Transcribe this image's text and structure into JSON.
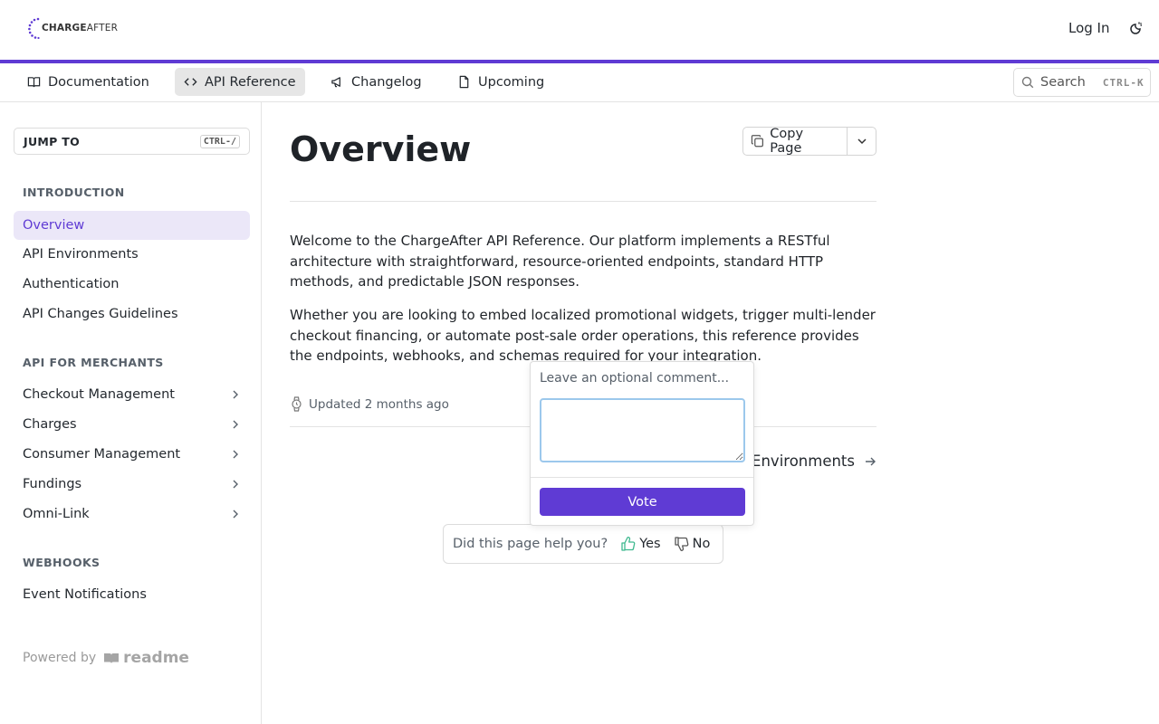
{
  "header": {
    "logo_text_bold": "CHARGE",
    "logo_text_thin": "AFTER",
    "login_label": "Log In",
    "theme_icon": "theme-toggle-icon",
    "accent_color": "#5f3bd4"
  },
  "nav": {
    "tabs": [
      {
        "label": "Documentation",
        "icon": "book-icon",
        "active": false
      },
      {
        "label": "API Reference",
        "icon": "code-icon",
        "active": true
      },
      {
        "label": "Changelog",
        "icon": "megaphone-icon",
        "active": false
      },
      {
        "label": "Upcoming",
        "icon": "document-icon",
        "active": false
      }
    ],
    "search_label": "Search",
    "search_shortcut": "CTRL-K"
  },
  "sidebar": {
    "jump_label": "JUMP TO",
    "jump_shortcut": "CTRL-/",
    "sections": [
      {
        "title": "INTRODUCTION",
        "items": [
          {
            "label": "Overview",
            "active": true
          },
          {
            "label": "API Environments"
          },
          {
            "label": "Authentication"
          },
          {
            "label": "API Changes Guidelines"
          }
        ]
      },
      {
        "title": "API FOR MERCHANTS",
        "items": [
          {
            "label": "Checkout Management",
            "expandable": true
          },
          {
            "label": "Charges",
            "expandable": true
          },
          {
            "label": "Consumer Management",
            "expandable": true
          },
          {
            "label": "Fundings",
            "expandable": true
          },
          {
            "label": "Omni-Link",
            "expandable": true
          }
        ]
      },
      {
        "title": "WEBHOOKS",
        "items": [
          {
            "label": "Event Notifications"
          }
        ]
      }
    ],
    "powered_by": "Powered by",
    "powered_brand": "readme"
  },
  "main": {
    "title": "Overview",
    "copy_label": "Copy Page",
    "paragraphs": [
      "Welcome to the ChargeAfter API Reference. Our platform implements a RESTful architecture with straightforward, resource-oriented endpoints, standard HTTP methods, and predictable JSON responses.",
      "Whether you are looking to embed localized promotional widgets, trigger multi-lender checkout financing, or automate post-sale order operations, this reference provides the endpoints, webhooks, and schemas required for your integration."
    ],
    "updated": "Updated 2 months ago",
    "next_link": "Environments"
  },
  "feedback": {
    "question": "Did this page help you?",
    "yes": "Yes",
    "no": "No",
    "comment_placeholder": "Leave an optional comment...",
    "comment_value": "",
    "vote_label": "Vote"
  }
}
